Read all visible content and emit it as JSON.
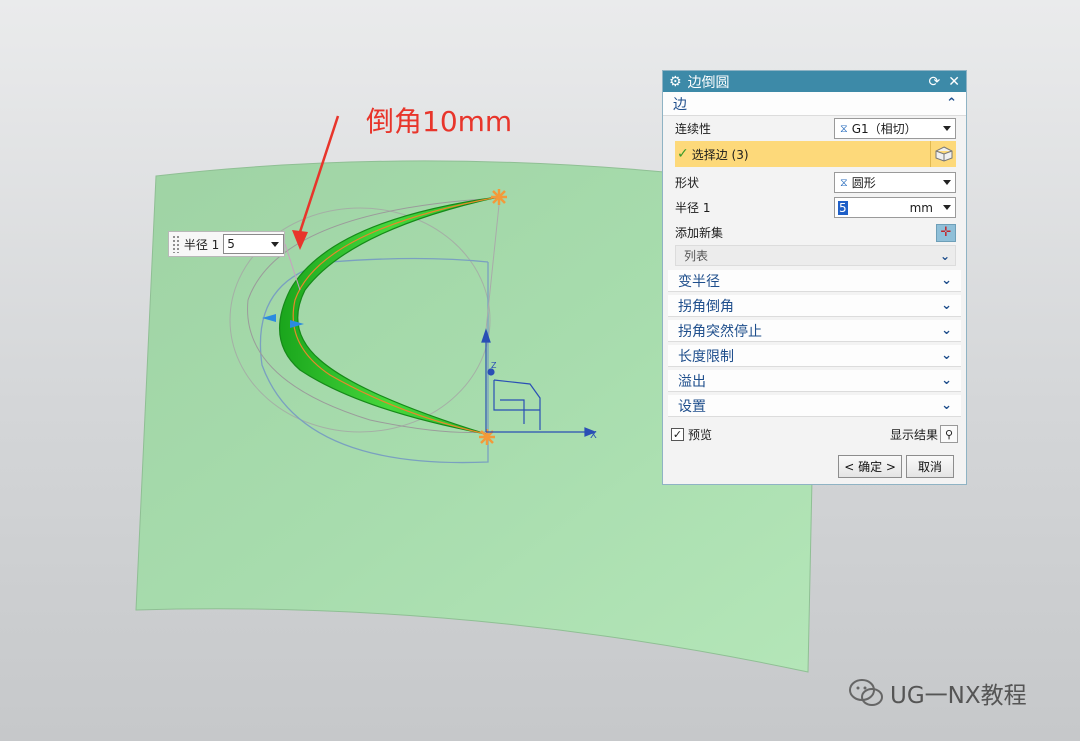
{
  "annotation": "倒角10mm",
  "radius_popup": {
    "label": "半径 1",
    "value": "5"
  },
  "axis_labels": {
    "x": "X",
    "z": "Z"
  },
  "dialog": {
    "title": "边倒圆",
    "title_controls": {
      "reset": "⟳",
      "close": "✕"
    },
    "edge_section": {
      "title": "边",
      "continuity_label": "连续性",
      "continuity_value": "G1（相切）",
      "select_edge": "选择边 (3)",
      "shape_label": "形状",
      "shape_value": "圆形",
      "radius_label": "半径 1",
      "radius_value": "5",
      "radius_unit": "mm",
      "add_new_set": "添加新集",
      "list_label": "列表"
    },
    "collapsed_sections": [
      "变半径",
      "拐角倒角",
      "拐角突然停止",
      "长度限制",
      "溢出",
      "设置"
    ],
    "preview": {
      "label": "预览",
      "checked": true
    },
    "show_result": "显示结果",
    "ok_button": "< 确定 >",
    "cancel_button": "取消"
  },
  "watermark": "UG一NX教程",
  "colors": {
    "surface": "#a9ddb0",
    "fillet": "#2fc62c",
    "title_bar": "#3d8aa8",
    "selected_row": "#fdd97a",
    "annotation": "#e8352b"
  }
}
